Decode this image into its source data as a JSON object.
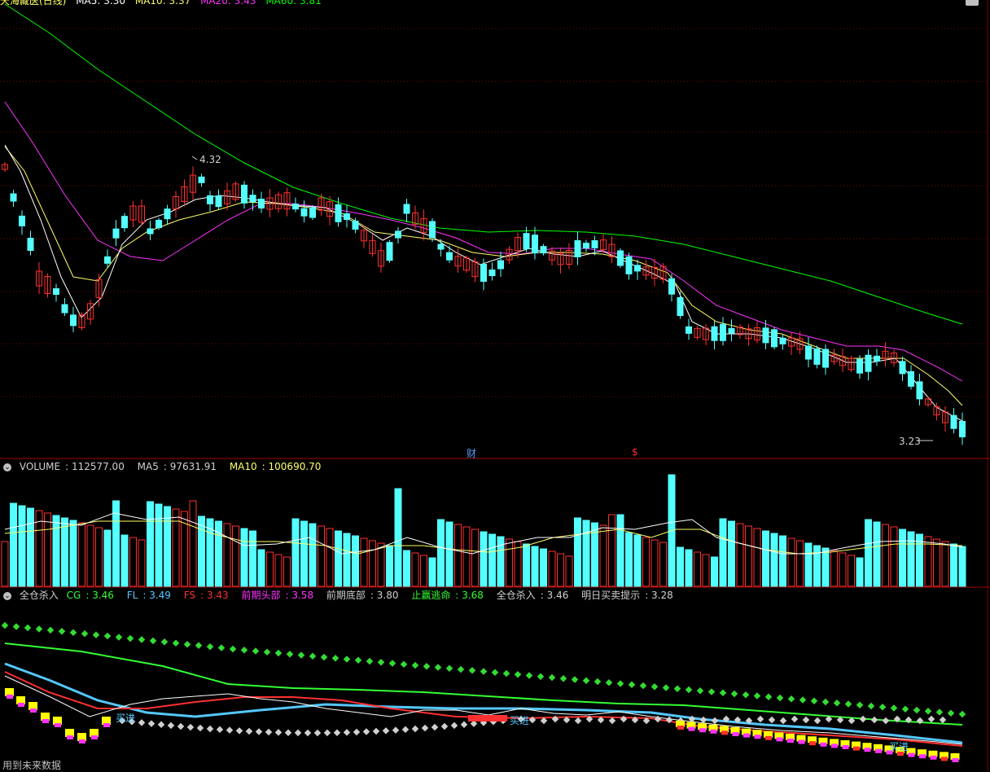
{
  "header": {
    "title_fragment": "天海藏医(日线)",
    "indicators": [
      "MA5: 3.30",
      "MA10: 3.37",
      "MA20: 3.43",
      "MA60: 3.81"
    ]
  },
  "main_chart": {
    "high_label": "4.32",
    "low_label": "3.23",
    "markers": [
      {
        "text": "财",
        "color": "#5b9bff"
      },
      {
        "text": "$",
        "color": "#ff3030"
      }
    ]
  },
  "volume_panel": {
    "legend": [
      {
        "label": "VOLUME",
        "value": "112577.00",
        "color": "#d0d0d0"
      },
      {
        "label": "MA5",
        "value": "97631.91",
        "color": "#d0d0d0"
      },
      {
        "label": "MA10",
        "value": "100690.70",
        "color": "#ffff66"
      }
    ]
  },
  "indicator_panel": {
    "title": "全仓杀入",
    "legend": [
      {
        "label": "CG",
        "value": "3.46",
        "color": "#33ff33"
      },
      {
        "label": "FL",
        "value": "3.49",
        "color": "#55c8ff"
      },
      {
        "label": "FS",
        "value": "3.43",
        "color": "#ff3030"
      },
      {
        "label": "前期头部",
        "value": "3.58",
        "color": "#ff33ff"
      },
      {
        "label": "前期底部",
        "value": "3.80",
        "color": "#d0d0d0"
      },
      {
        "label": "止赢逃命",
        "value": "3.68",
        "color": "#33ff33"
      },
      {
        "label": "全仓杀入",
        "value": "3.46",
        "color": "#d0d0d0"
      },
      {
        "label": "明日买卖提示",
        "value": "3.28",
        "color": "#d0d0d0"
      }
    ],
    "signals": [
      "买进",
      "买进",
      "买进"
    ]
  },
  "footer": {
    "text": "用到未来数据"
  },
  "colors": {
    "up": "#ff3030",
    "down": "#54ffff",
    "ma5": "#ffffff",
    "ma10": "#ffff66",
    "ma20": "#ff33ff",
    "ma60": "#00ff00",
    "grid": "#800000",
    "separator": "#a00000"
  },
  "chart_data": [
    {
      "type": "candlestick",
      "series": [
        {
          "name": "MA5",
          "color": "#ffffff"
        },
        {
          "name": "MA10",
          "color": "#ffff66"
        },
        {
          "name": "MA20",
          "color": "#ff33ff"
        },
        {
          "name": "MA60",
          "color": "#00ff00"
        }
      ],
      "annotations": [
        "4.32",
        "3.23"
      ],
      "grid": true
    },
    {
      "type": "bar",
      "series": [
        {
          "name": "VOLUME",
          "color": "#54ffff"
        },
        {
          "name": "MA5",
          "color": "#ffffff"
        },
        {
          "name": "MA10",
          "color": "#ffff66"
        }
      ]
    },
    {
      "type": "line",
      "series": [
        {
          "name": "CG",
          "color": "#33ff33"
        },
        {
          "name": "FL",
          "color": "#55c8ff"
        },
        {
          "name": "FS",
          "color": "#ff3030"
        },
        {
          "name": "止赢逃命",
          "color": "#33ff33"
        },
        {
          "name": "全仓杀入",
          "color": "#d0d0d0"
        }
      ]
    }
  ]
}
